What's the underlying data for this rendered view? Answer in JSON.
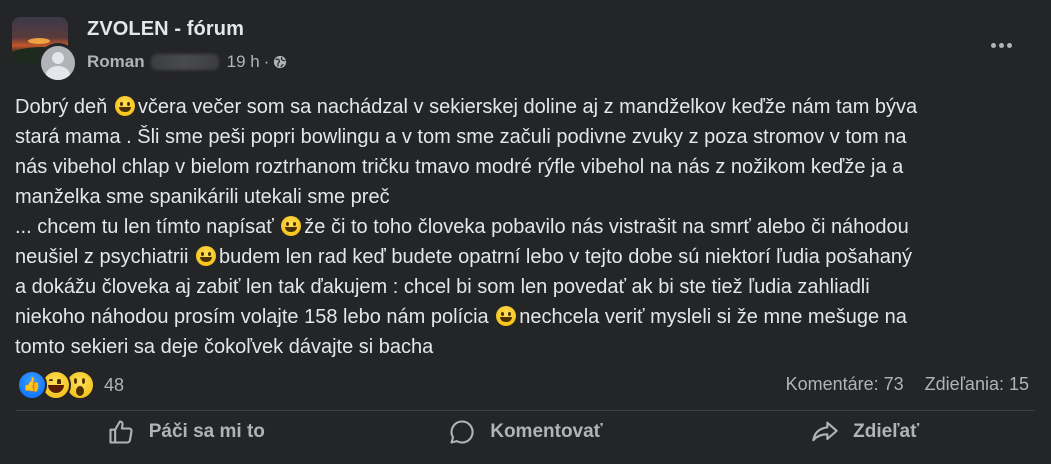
{
  "header": {
    "group_name": "ZVOLEN - fórum",
    "author": "Roman",
    "time": "19 h",
    "separator": "·"
  },
  "post": {
    "lines": [
      [
        "Dobrý deň ",
        "emoji",
        "včera večer som sa nachádzal v sekierskej doline aj z mandželkov keďže nám tam býva"
      ],
      [
        "stará mama . Šli sme peši popri bowlingu a v tom sme začuli podivne zvuky z poza stromov v tom na"
      ],
      [
        "nás vibehol chlap v bielom roztrhanom tričku tmavo modré rýfle vibehol na nás z nožikom keďže ja a"
      ],
      [
        "manželka sme spanikárili utekali sme preč"
      ],
      [
        "... chcem tu len tímto napísať ",
        "emoji",
        "že či to toho človeka pobavilo nás vistrašit na smrť alebo či náhodou"
      ],
      [
        "neušiel z psychiatrii ",
        "emoji",
        "budem len rad keď budete opatrní lebo v tejto dobe sú niektorí ľudia pošahaný"
      ],
      [
        "a dokážu človeka aj zabiť len tak ďakujem : chcel bi som len povedať ak bi ste tiež ľudia zahliadli"
      ],
      [
        "niekoho náhodou prosím volajte 158 lebo nám polícia ",
        "emoji",
        "nechcela veriť mysleli si že mne mešuge na"
      ],
      [
        "tomto sekieri sa deje čokoľvek dávajte si bacha"
      ]
    ]
  },
  "reactions": {
    "types": [
      "like",
      "haha",
      "wow"
    ],
    "count": "48"
  },
  "stats": {
    "comments": "Komentáre: 73",
    "shares": "Zdieľania: 15"
  },
  "actions": {
    "like": "Páči sa mi to",
    "comment": "Komentovať",
    "share": "Zdieľať"
  },
  "colors": {
    "background": "#242526",
    "text_primary": "#e4e6eb",
    "text_secondary": "#b0b3b8",
    "divider": "#3e4042",
    "like_blue": "#0866ff"
  }
}
